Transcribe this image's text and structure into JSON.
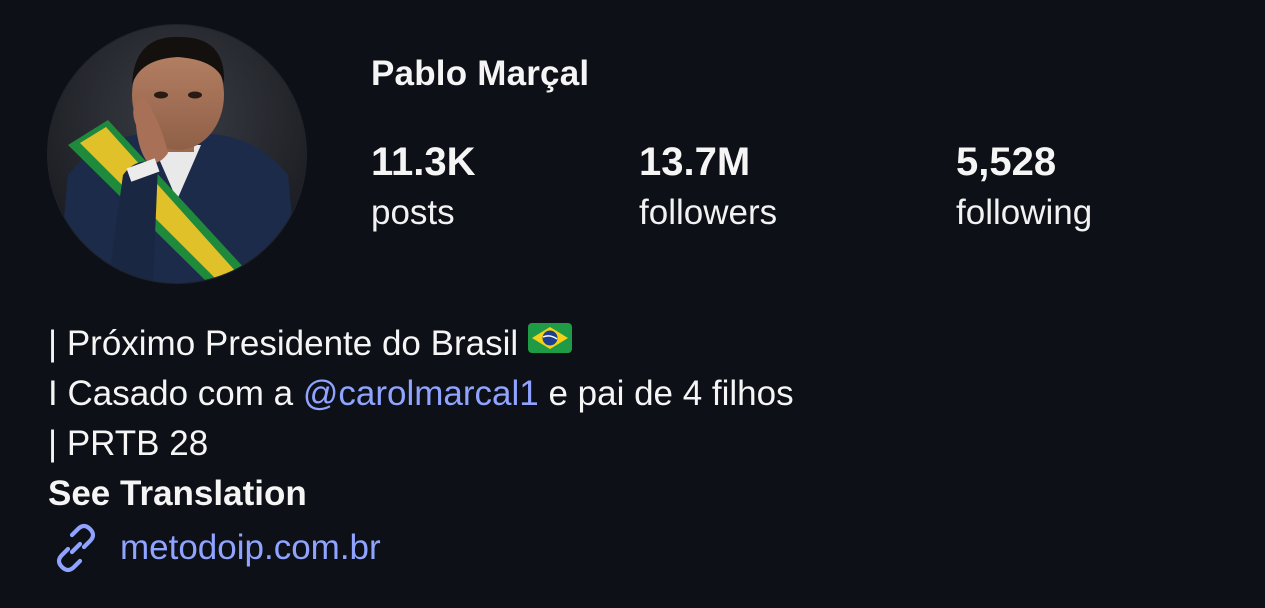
{
  "profile": {
    "username": "Pablo Marçal",
    "avatar_icon": "profile-photo"
  },
  "stats": {
    "posts": {
      "value": "11.3K",
      "label": "posts"
    },
    "followers": {
      "value": "13.7M",
      "label": "followers"
    },
    "following": {
      "value": "5,528",
      "label": "following"
    }
  },
  "bio": {
    "line1_text": "| Próximo Presidente do Brasil",
    "line1_emoji": "brazil-flag-emoji",
    "line2_prefix": "I Casado com a ",
    "line2_mention": "@carolmarcal1",
    "line2_suffix": " e pai de 4 filhos",
    "line3_text": "| PRTB 28",
    "see_translation": "See Translation",
    "link_icon": "link-icon",
    "link_text": "metodoip.com.br"
  },
  "colors": {
    "background": "#0d1016",
    "text": "#f5f5f5",
    "accent_link": "#8fa3ff"
  }
}
